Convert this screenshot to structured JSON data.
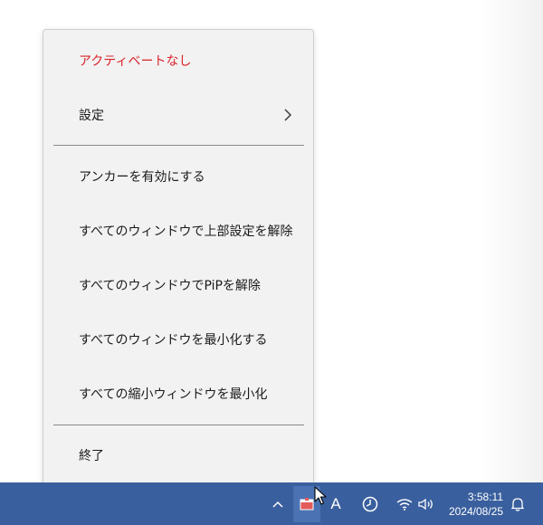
{
  "menu": {
    "items": [
      {
        "label": "アクティベートなし",
        "color": "#d9242a"
      },
      {
        "label": "設定",
        "has_submenu": true,
        "icon": "chevron-right-icon"
      },
      {
        "label": "アンカーを有効にする"
      },
      {
        "label": "すべてのウィンドウで上部設定を解除"
      },
      {
        "label": "すべてのウィンドウでPiPを解除"
      },
      {
        "label": "すべてのウィンドウを最小化する"
      },
      {
        "label": "すべての縮小ウィンドウを最小化"
      },
      {
        "label": "終了"
      }
    ]
  },
  "taskbar": {
    "background": "#3a5f9e",
    "tray_icons": [
      "chevron-up-icon",
      "app-tray-icon",
      "ime-mode-icon",
      "clock-app-icon",
      "wifi-icon",
      "speaker-icon",
      "notification-bell-icon"
    ],
    "ime_mode": "A",
    "clock": {
      "time": "3:58:11",
      "date": "2024/08/25"
    }
  }
}
